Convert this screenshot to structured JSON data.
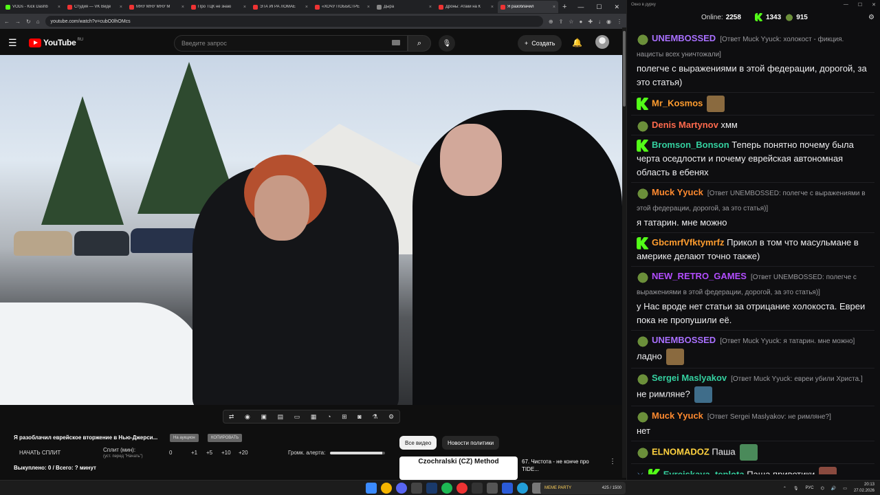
{
  "browser": {
    "tabs": [
      {
        "label": "VODs - Kick Dashb",
        "color": "#53fc18"
      },
      {
        "label": "Студия — VK Виде",
        "color": "#e33"
      },
      {
        "label": "МЯУ МЯУ МЯУ М",
        "color": "#e33"
      },
      {
        "label": "Про ТЦК не знаю",
        "color": "#e33"
      },
      {
        "label": "ЭТА ИГРА ЛОМАЕ",
        "color": "#e33"
      },
      {
        "label": "«ХОЧУ ПОБЫСТРЕ",
        "color": "#e33"
      },
      {
        "label": "Дыра",
        "color": "#888"
      },
      {
        "label": "Дроны: Атаки на К",
        "color": "#e33"
      },
      {
        "label": "Я разоблачил",
        "color": "#e33"
      }
    ],
    "url": "youtube.com/watch?v=cubO0lhOMcs"
  },
  "youtube": {
    "logo_text": "YouTube",
    "logo_region": "RU",
    "search_placeholder": "Введите запрос",
    "create_label": "Создать",
    "video_title": "Я разоблачил еврейское вторжение в Нью-Джерси...",
    "chip_auction": "На аукцион",
    "chip_copy": "КОПИРОВАТЬ",
    "split_start": "НАЧАТЬ СПЛИТ",
    "split_label": "Сплит (мин):",
    "split_sub": "(уст. перед \"Начать\")",
    "split_values": [
      "0",
      "+1",
      "+5",
      "+10",
      "+20"
    ],
    "alert_volume_label": "Громк. алерта:",
    "alert_volume": 0.95,
    "bought": "Выкуплено: 0 / Всего: ? минут",
    "tabs": [
      "Все видео",
      "Новости политики"
    ],
    "rec_thumb_text": "Czochralski (CZ) Method",
    "rec_title": "67. Чистота - не конче про TIDE..."
  },
  "chat": {
    "window_title": "Окно в дурку",
    "online_label": "Online:",
    "online_count": "2258",
    "kick_count": "1343",
    "other_count": "915",
    "messages": [
      {
        "user": "UNEMBOSSED",
        "color": "#a970ff",
        "badge": "pepe",
        "reply": "[Ответ Muck Yyuck: холокост - фикция. нацисты всех уничтожали]",
        "text": "полегче с выражениями в этой федерации, дорогой, за это статья)"
      },
      {
        "user": "Mr_Kosmos",
        "color": "#ff9d2f",
        "badge": "k",
        "reply": "",
        "text": "",
        "emote": true
      },
      {
        "user": "Denis Martynov",
        "color": "#ff6a4d",
        "badge": "pepe",
        "reply": "",
        "text": "хмм"
      },
      {
        "user": "Bromson_Bonson",
        "color": "#34d1a0",
        "badge": "k",
        "reply": "",
        "text": "Теперь понятно почему была черта оседлости и почему еврейская автономная область в ебенях"
      },
      {
        "user": "Muck Yyuck",
        "color": "#ff8a2f",
        "badge": "pepe",
        "reply": "[Ответ UNEMBOSSED: полегче с выражениями в этой федерации, дорогой, за это статья)]",
        "text": "я татарин. мне можно"
      },
      {
        "user": "GbcmrfVfktymrfz",
        "color": "#ff9d2f",
        "badge": "k",
        "reply": "",
        "text": "Прикол в том что масульмане в америке делают точно также)"
      },
      {
        "user": "NEW_RETRO_GAMES",
        "color": "#b34dff",
        "badge": "pepe",
        "reply": "[Ответ UNEMBOSSED: полегче с выражениями в этой федерации, дорогой, за это статья)]",
        "text": "у Нас вроде нет статьи за отрицание холокоста. Евреи пока не пропушили её."
      },
      {
        "user": "UNEMBOSSED",
        "color": "#a970ff",
        "badge": "pepe",
        "reply": "[Ответ Muck Yyuck: я татарин. мне можно]",
        "text": "ладно",
        "emote": true
      },
      {
        "user": "Sergei Maslyakov",
        "color": "#34d1a0",
        "badge": "pepe",
        "reply": "[Ответ Muck Yyuck: евреи убили Христа.]",
        "text": "не римляне?",
        "emote": true
      },
      {
        "user": "Muck Yyuck",
        "color": "#ff8a2f",
        "badge": "pepe",
        "reply": "[Ответ Sergei Maslyakov: не римляне?]",
        "text": "нет"
      },
      {
        "user": "ELNOMADOZ",
        "color": "#ffd23f",
        "badge": "pepe",
        "reply": "",
        "text": "Паша",
        "emote": true
      },
      {
        "user": "Evreiskaya_teplota",
        "color": "#34d1a0",
        "badge": "k",
        "badge2": "sword",
        "reply": "",
        "text": "Паша приветики",
        "emote": true
      }
    ]
  },
  "taskbar": {
    "media_label": "MEME PARTY",
    "media_count": "425 / 1500",
    "lang": "РУС",
    "time": "20:13",
    "date": "27.02.2026"
  }
}
